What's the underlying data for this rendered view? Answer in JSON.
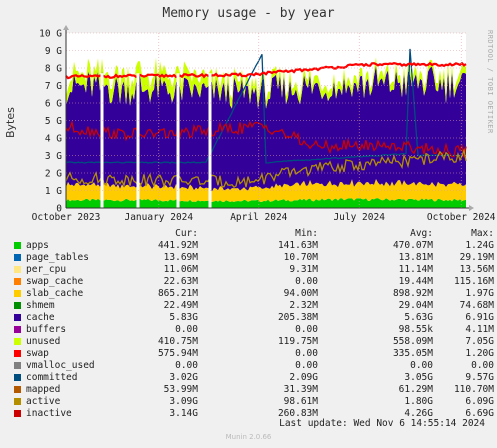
{
  "title": "Memory usage - by year",
  "side_label": "RRDTOOL / TOBI OETIKER",
  "footer": "Munin 2.0.66",
  "last_update": "Last update: Wed Nov  6 14:55:14 2024",
  "legend": {
    "headers": [
      "Cur:",
      "Min:",
      "Avg:",
      "Max:"
    ],
    "rows": [
      {
        "name": "apps",
        "color": "#00cc00",
        "cur": "441.92M",
        "min": "141.63M",
        "avg": "470.07M",
        "max": "1.24G"
      },
      {
        "name": "page_tables",
        "color": "#0066b3",
        "cur": "13.69M",
        "min": "10.70M",
        "avg": "13.81M",
        "max": "29.19M"
      },
      {
        "name": "per_cpu",
        "color": "#ffe680",
        "cur": "11.06M",
        "min": "9.31M",
        "avg": "11.14M",
        "max": "13.56M"
      },
      {
        "name": "swap_cache",
        "color": "#ff8000",
        "cur": "22.63M",
        "min": "0.00",
        "avg": "19.44M",
        "max": "115.16M"
      },
      {
        "name": "slab_cache",
        "color": "#ffcc00",
        "cur": "865.21M",
        "min": "94.00M",
        "avg": "898.92M",
        "max": "1.97G"
      },
      {
        "name": "shmem",
        "color": "#008f00",
        "cur": "22.49M",
        "min": "2.32M",
        "avg": "29.04M",
        "max": "74.68M"
      },
      {
        "name": "cache",
        "color": "#330099",
        "cur": "5.83G",
        "min": "205.38M",
        "avg": "5.63G",
        "max": "6.91G"
      },
      {
        "name": "buffers",
        "color": "#990099",
        "cur": "0.00",
        "min": "0.00",
        "avg": "98.55k",
        "max": "4.11M"
      },
      {
        "name": "unused",
        "color": "#ccff00",
        "cur": "410.75M",
        "min": "119.75M",
        "avg": "558.09M",
        "max": "7.05G"
      },
      {
        "name": "swap",
        "color": "#ff0000",
        "cur": "575.94M",
        "min": "0.00",
        "avg": "335.05M",
        "max": "1.20G"
      },
      {
        "name": "vmalloc_used",
        "color": "#808080",
        "cur": "0.00",
        "min": "0.00",
        "avg": "0.00",
        "max": "0.00"
      },
      {
        "name": "committed",
        "color": "#004d80",
        "cur": "3.02G",
        "min": "2.09G",
        "avg": "3.05G",
        "max": "9.57G"
      },
      {
        "name": "mapped",
        "color": "#b35a00",
        "cur": "53.99M",
        "min": "31.39M",
        "avg": "61.29M",
        "max": "110.70M"
      },
      {
        "name": "active",
        "color": "#b38f00",
        "cur": "3.09G",
        "min": "98.61M",
        "avg": "1.80G",
        "max": "6.09G"
      },
      {
        "name": "inactive",
        "color": "#cc0000",
        "cur": "3.14G",
        "min": "260.83M",
        "avg": "4.26G",
        "max": "6.69G"
      }
    ]
  },
  "chart_data": {
    "type": "area",
    "title": "Memory usage - by year",
    "ylabel": "Bytes",
    "ylim": [
      0,
      10
    ],
    "y_unit": "G",
    "y_ticks": [
      "0",
      "1 G",
      "2 G",
      "3 G",
      "4 G",
      "5 G",
      "6 G",
      "7 G",
      "8 G",
      "9 G",
      "10 G"
    ],
    "x_ticks": [
      "October 2023",
      "January 2024",
      "April 2024",
      "July 2024",
      "October 2024"
    ],
    "x_tick_pos": [
      0.0,
      0.232,
      0.482,
      0.733,
      0.988
    ],
    "grid": true,
    "stack": [
      {
        "name": "apps",
        "color": "#00cc00",
        "points": [
          [
            0,
            0.45
          ],
          [
            0.2,
            0.45
          ],
          [
            0.45,
            0.4
          ],
          [
            0.7,
            0.5
          ],
          [
            1,
            0.45
          ]
        ]
      },
      {
        "name": "slab_cache",
        "color": "#ffcc00",
        "points": [
          [
            0,
            0.9
          ],
          [
            0.2,
            0.8
          ],
          [
            0.45,
            0.7
          ],
          [
            0.6,
            0.9
          ],
          [
            0.8,
            0.95
          ],
          [
            1,
            0.85
          ]
        ]
      },
      {
        "name": "cache",
        "color": "#330099",
        "points": [
          [
            0,
            5.6
          ],
          [
            0.3,
            5.5
          ],
          [
            0.5,
            5.4
          ],
          [
            0.7,
            5.6
          ],
          [
            1,
            5.8
          ]
        ]
      },
      {
        "name": "unused",
        "color": "#ccff00",
        "points": [
          [
            0,
            0.6
          ],
          [
            0.18,
            0.9
          ],
          [
            0.3,
            0.8
          ],
          [
            0.45,
            0.5
          ],
          [
            0.65,
            0.4
          ],
          [
            1,
            0.45
          ]
        ]
      }
    ],
    "lines": [
      {
        "name": "committed",
        "color": "#004d80",
        "points": [
          [
            0,
            2.6
          ],
          [
            0.35,
            2.6
          ],
          [
            0.49,
            8.8
          ],
          [
            0.5,
            2.6
          ],
          [
            0.85,
            3.1
          ],
          [
            0.86,
            9.1
          ],
          [
            0.88,
            3.0
          ],
          [
            1,
            3.0
          ]
        ]
      },
      {
        "name": "swap",
        "color": "#ff0000",
        "points": [
          [
            0,
            7.5
          ],
          [
            0.45,
            7.6
          ],
          [
            0.6,
            7.9
          ],
          [
            0.75,
            8.2
          ],
          [
            1,
            8.2
          ]
        ]
      },
      {
        "name": "inactive",
        "color": "#cc0000",
        "points": [
          [
            0,
            4.6
          ],
          [
            0.15,
            4.2
          ],
          [
            0.3,
            4.3
          ],
          [
            0.5,
            4.7
          ],
          [
            0.62,
            3.5
          ],
          [
            0.8,
            3.6
          ],
          [
            1,
            3.2
          ]
        ]
      },
      {
        "name": "active",
        "color": "#b38f00",
        "points": [
          [
            0,
            1.7
          ],
          [
            0.2,
            1.6
          ],
          [
            0.45,
            1.5
          ],
          [
            0.6,
            2.2
          ],
          [
            0.8,
            2.6
          ],
          [
            1,
            3.0
          ]
        ]
      }
    ],
    "gaps": [
      0.09,
      0.18,
      0.28,
      0.36
    ]
  }
}
